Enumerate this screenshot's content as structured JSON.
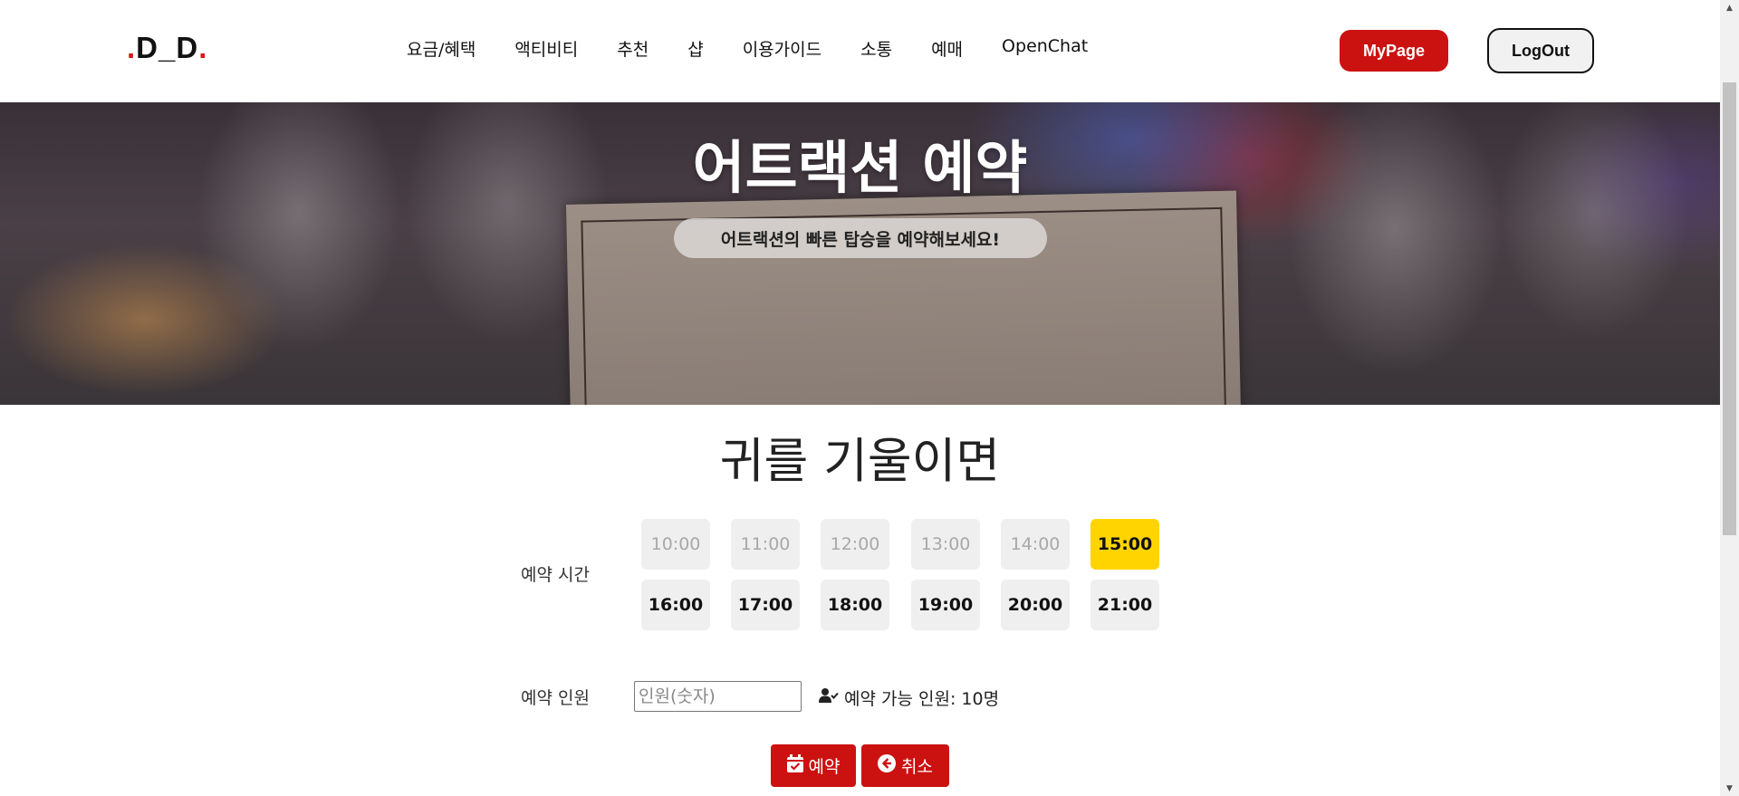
{
  "header": {
    "logo": {
      "dot1": ".",
      "text": "D_D",
      "dot2": "."
    },
    "nav": [
      "요금/혜택",
      "액티비티",
      "추천",
      "샵",
      "이용가이드",
      "소통",
      "예매",
      "OpenChat"
    ],
    "mypage_label": "MyPage",
    "logout_label": "LogOut"
  },
  "hero": {
    "title": "어트랙션 예약",
    "subtitle": "어트랙션의 빠른 탑승을 예약해보세요!"
  },
  "reservation": {
    "attraction_name": "귀를 기울이면",
    "time_label": "예약 시간",
    "time_slots": [
      {
        "time": "10:00",
        "state": "disabled"
      },
      {
        "time": "11:00",
        "state": "disabled"
      },
      {
        "time": "12:00",
        "state": "disabled"
      },
      {
        "time": "13:00",
        "state": "disabled"
      },
      {
        "time": "14:00",
        "state": "disabled"
      },
      {
        "time": "15:00",
        "state": "selected"
      },
      {
        "time": "16:00",
        "state": "available"
      },
      {
        "time": "17:00",
        "state": "available"
      },
      {
        "time": "18:00",
        "state": "available"
      },
      {
        "time": "19:00",
        "state": "available"
      },
      {
        "time": "20:00",
        "state": "available"
      },
      {
        "time": "21:00",
        "state": "available"
      }
    ],
    "people_label": "예약 인원",
    "people_placeholder": "인원(숫자)",
    "people_value": "",
    "capacity_text": "예약 가능 인원: 10명",
    "reserve_label": "예약",
    "cancel_label": "취소"
  },
  "colors": {
    "accent_red": "#cc1111",
    "selected_slot": "#ffd400",
    "logo_dot": "#e01313"
  },
  "icons": [
    "user-check-icon",
    "calendar-check-icon",
    "arrow-left-circle-icon"
  ]
}
